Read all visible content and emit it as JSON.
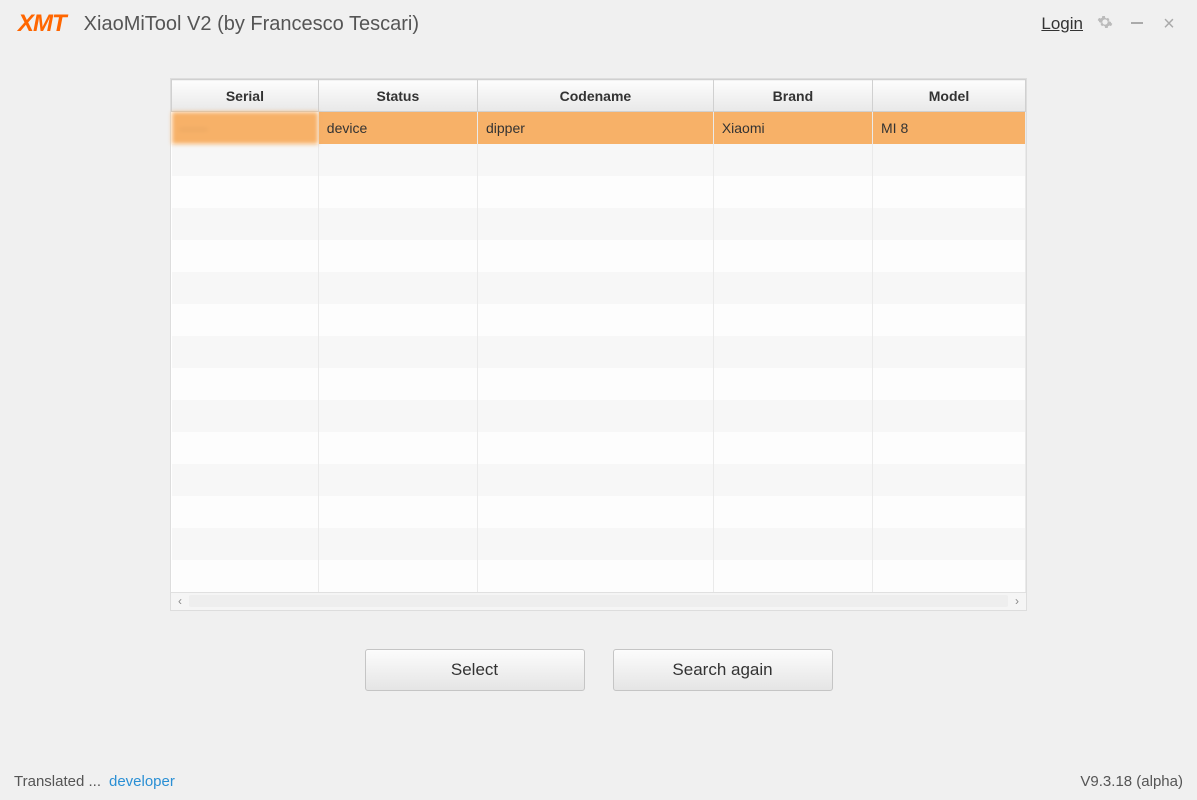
{
  "header": {
    "logo_text": "XMT",
    "title": "XiaoMiTool V2 (by Francesco Tescari)",
    "login": "Login"
  },
  "table": {
    "headers": [
      "Serial",
      "Status",
      "Codename",
      "Brand",
      "Model"
    ],
    "rows": [
      {
        "serial": "——",
        "status": "device",
        "codename": "dipper",
        "brand": "Xiaomi",
        "model": "MI 8"
      }
    ],
    "empty_rows": 14
  },
  "buttons": {
    "select": "Select",
    "search_again": "Search again"
  },
  "footer": {
    "translated": "Translated ...",
    "developer": "developer",
    "version": "V9.3.18 (alpha)"
  }
}
